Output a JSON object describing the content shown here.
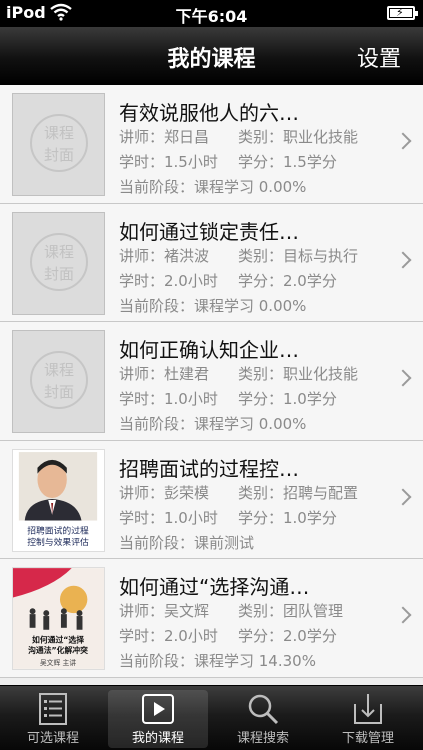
{
  "status": {
    "carrier": "iPod",
    "time": "下午6:04"
  },
  "nav": {
    "title": "我的课程",
    "settings": "设置"
  },
  "placeholder_text": [
    "课程",
    "封面"
  ],
  "courses": [
    {
      "title": "有效说服他人的六…",
      "teacher": "讲师：郑日昌",
      "category": "类别：职业化技能",
      "hours": "学时：1.5小时",
      "credits": "学分：1.5学分",
      "stage": "当前阶段：课程学习 0.00%",
      "cover": "placeholder"
    },
    {
      "title": "如何通过锁定责任…",
      "teacher": "讲师：褚洪波",
      "category": "类别：目标与执行",
      "hours": "学时：2.0小时",
      "credits": "学分：2.0学分",
      "stage": "当前阶段：课程学习 0.00%",
      "cover": "placeholder"
    },
    {
      "title": "如何正确认知企业…",
      "teacher": "讲师：杜建君",
      "category": "类别：职业化技能",
      "hours": "学时：1.0小时",
      "credits": "学分：1.0学分",
      "stage": "当前阶段：课程学习 0.00%",
      "cover": "placeholder"
    },
    {
      "title": "招聘面试的过程控…",
      "teacher": "讲师：彭荣模",
      "category": "类别：招聘与配置",
      "hours": "学时：1.0小时",
      "credits": "学分：1.0学分",
      "stage": "当前阶段：课前测试",
      "cover": "portrait",
      "cover_text": [
        "招聘面试的过程",
        "控制与效果评估"
      ]
    },
    {
      "title": "如何通过“选择沟通…",
      "teacher": "讲师：吴文辉",
      "category": "类别：团队管理",
      "hours": "学时：2.0小时",
      "credits": "学分：2.0学分",
      "stage": "当前阶段：课程学习 14.30%",
      "cover": "figures",
      "cover_text": [
        "如何通过“选择",
        "沟通法”化解冲突",
        "吴文辉 主讲"
      ]
    }
  ],
  "tabs": [
    {
      "label": "可选课程",
      "icon": "list-icon"
    },
    {
      "label": "我的课程",
      "icon": "play-icon"
    },
    {
      "label": "课程搜索",
      "icon": "search-icon"
    },
    {
      "label": "下载管理",
      "icon": "download-icon"
    }
  ],
  "colors": {
    "nav_bg": "#111111",
    "row_bg": "#f6f6f6",
    "meta_text": "#8a8a8a"
  }
}
